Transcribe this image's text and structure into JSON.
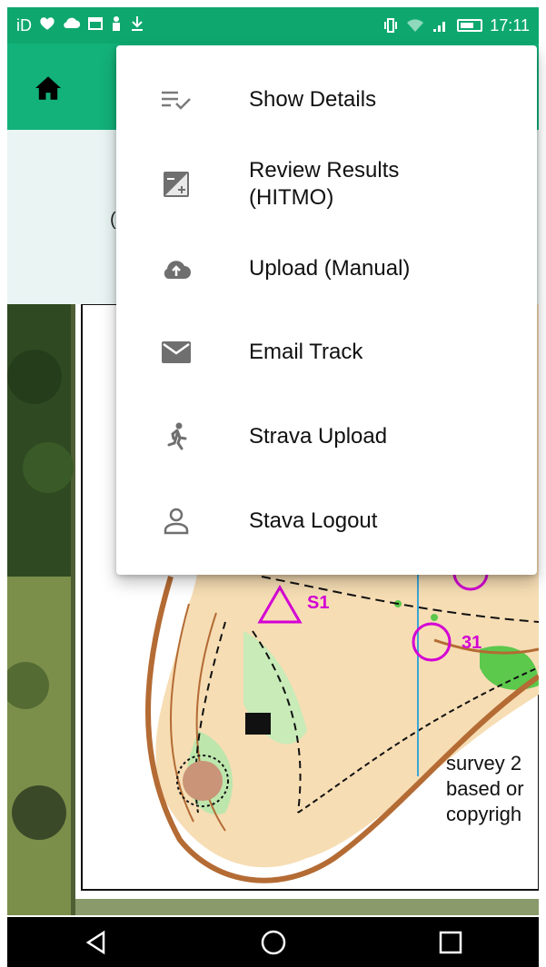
{
  "status_bar": {
    "left_icons": [
      "iD",
      "heart-icon",
      "cloud-icon",
      "calendar-icon",
      "person-icon",
      "download-icon"
    ],
    "time": "17:11"
  },
  "app_bar": {
    "home_icon": "home-icon"
  },
  "info_band": {
    "partial_char": "("
  },
  "menu": {
    "items": [
      {
        "label": "Show Details",
        "icon": "list-check-icon"
      },
      {
        "label": "Review Results\n(HITMO)",
        "icon": "exposure-icon"
      },
      {
        "label": "Upload (Manual)",
        "icon": "cloud-upload-icon"
      },
      {
        "label": "Email Track",
        "icon": "email-icon"
      },
      {
        "label": "Strava Upload",
        "icon": "runner-icon"
      },
      {
        "label": "Stava Logout",
        "icon": "user-icon"
      }
    ]
  },
  "map": {
    "label_s1": "S1",
    "label_31": "31",
    "survey_text": "survey 2\nbased or\ncopyrigh",
    "colors": {
      "magenta": "#d400d4",
      "terrain": "#f6ddb4",
      "brown": "#b46b34",
      "green": "#79d36a",
      "blue": "#3ba6d8"
    }
  },
  "nav_bar": {
    "back_icon": "back-triangle-icon",
    "home_icon": "home-circle-icon",
    "recents_icon": "recents-square-icon"
  }
}
